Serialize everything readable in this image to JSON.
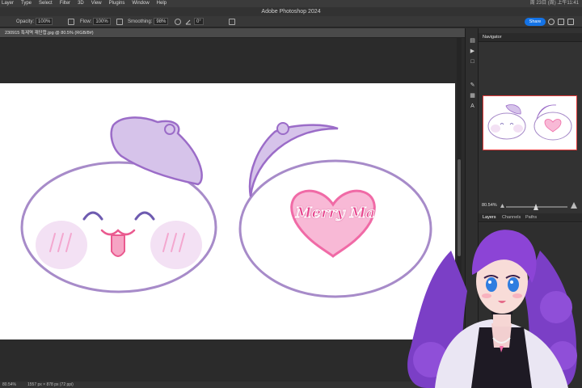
{
  "menubar": {
    "items": [
      "Layer",
      "Type",
      "Select",
      "Filter",
      "3D",
      "View",
      "Plugins",
      "Window",
      "Help"
    ],
    "system": "周 23日 (周) 上午11:41"
  },
  "window": {
    "title": "Adobe Photoshop 2024"
  },
  "options": {
    "opacity_label": "Opacity:",
    "opacity_value": "100%",
    "flow_label": "Flow:",
    "flow_value": "100%",
    "smoothing_label": "Smoothing:",
    "smoothing_value": "98%",
    "angle_value": "0°",
    "share_label": "Share"
  },
  "document": {
    "tab_title": "230915 특제역 재단합.jpg @ 80.5% (RGB/8#)"
  },
  "artwork": {
    "logo_text": "Merry Ma"
  },
  "panels": {
    "navigator_title": "Navigator",
    "zoom_value": "80.54%",
    "layers_tab": "Layers",
    "channels_tab": "Channels",
    "paths_tab": "Paths"
  },
  "status": {
    "zoom": "80.54%",
    "doc_size": "1557 px × 878 px (72 ppi)"
  },
  "colors": {
    "accent": "#1473e6",
    "outline_purple": "#a78bc9",
    "beret_purple": "#d6c3ea",
    "heart_pink": "#f06aa6",
    "nav_highlight": "#e23a3a"
  }
}
